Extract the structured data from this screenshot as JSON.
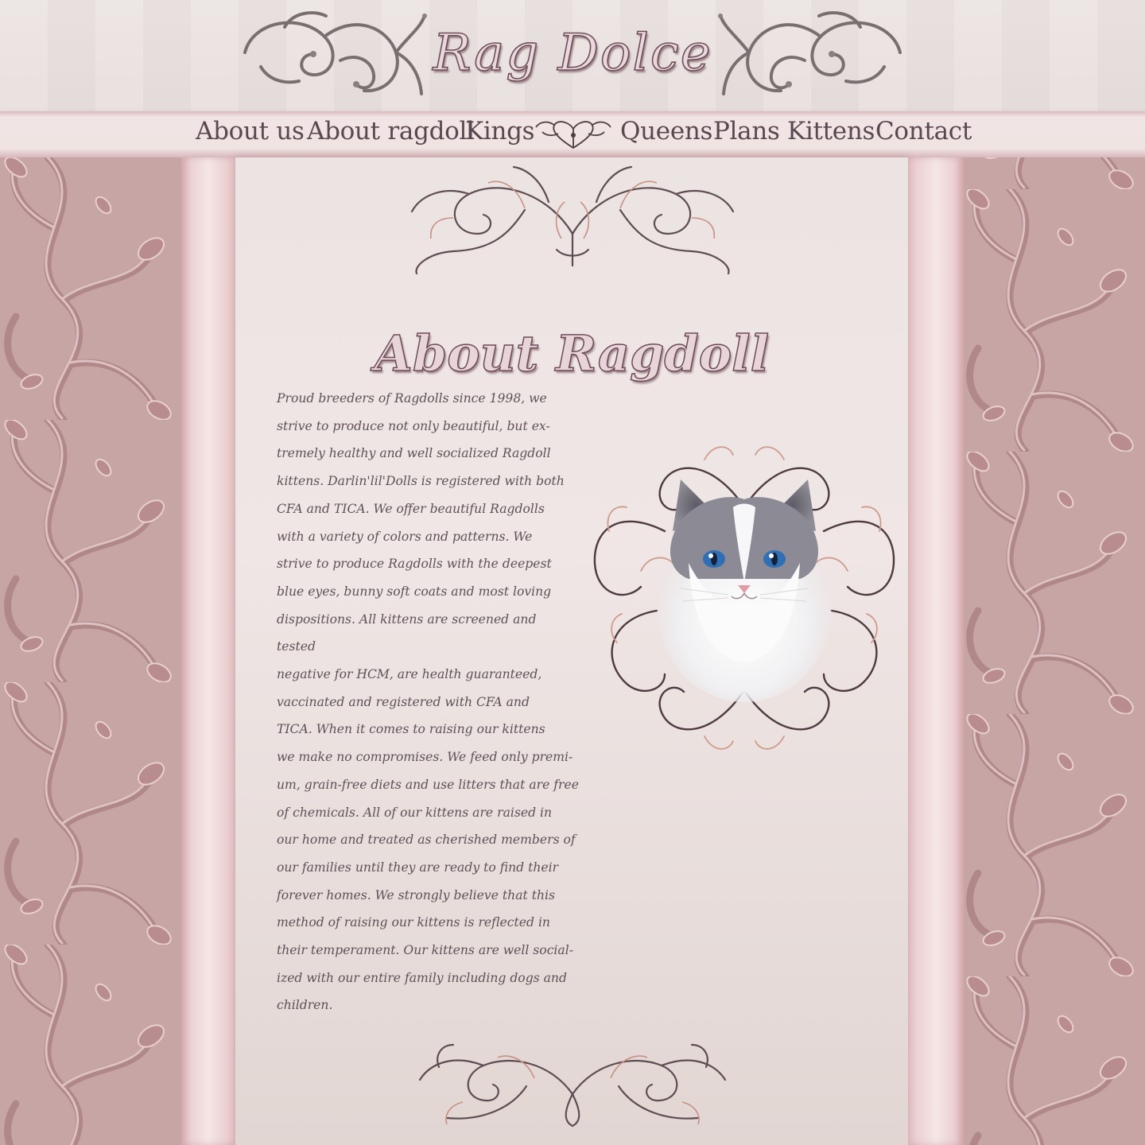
{
  "header": {
    "site_title": "Rag Dolce"
  },
  "nav": {
    "items": [
      {
        "label": "About us"
      },
      {
        "label": "About ragdoll"
      },
      {
        "label": "Kings"
      },
      {
        "label": "Queens"
      },
      {
        "label": "Plans"
      },
      {
        "label": "Kittens"
      },
      {
        "label": "Contact"
      }
    ],
    "emblem_icon": "heart-flourish-icon"
  },
  "main": {
    "page_title": "About Ragdoll",
    "body_lines": [
      "Proud breeders of Ragdolls since 1998, we",
      "strive to produce not only beautiful, but ex-",
      "tremely healthy and well socialized Ragdoll",
      "kittens. Darlin'lil'Dolls is registered with both",
      "CFA and TICA. We offer beautiful Ragdolls",
      "with a variety of colors and patterns. We",
      "strive to produce Ragdolls with the deepest",
      "blue eyes, bunny soft coats and most loving",
      "dispositions. All kittens are screened and tested",
      "negative for HCM, are health guaranteed,",
      "vaccinated and registered with CFA and",
      "TICA. When it comes to raising our kittens",
      "we make no compromises. We feed only premi-",
      "um, grain-free diets and use litters that are free",
      "of chemicals. All of our kittens are raised in",
      "our home and treated as cherished members of",
      "our families until they are ready to find their",
      "forever homes. We strongly believe that this",
      "method of raising our kittens is reflected in",
      "their temperament. Our kittens are well social-",
      "ized with our entire family including dogs and",
      "children."
    ],
    "image": {
      "subject": "ragdoll-cat-portrait",
      "frame": "ornamental-scroll-frame"
    }
  },
  "colors": {
    "side_panel": "#c7a5a5",
    "rail": "#f1dedf",
    "content_bg": "#ece4e2",
    "text": "#5f5058",
    "title_stroke": "#6e4b58",
    "ornament": "#7a6a6e",
    "ornament_rose": "#c08a80"
  }
}
